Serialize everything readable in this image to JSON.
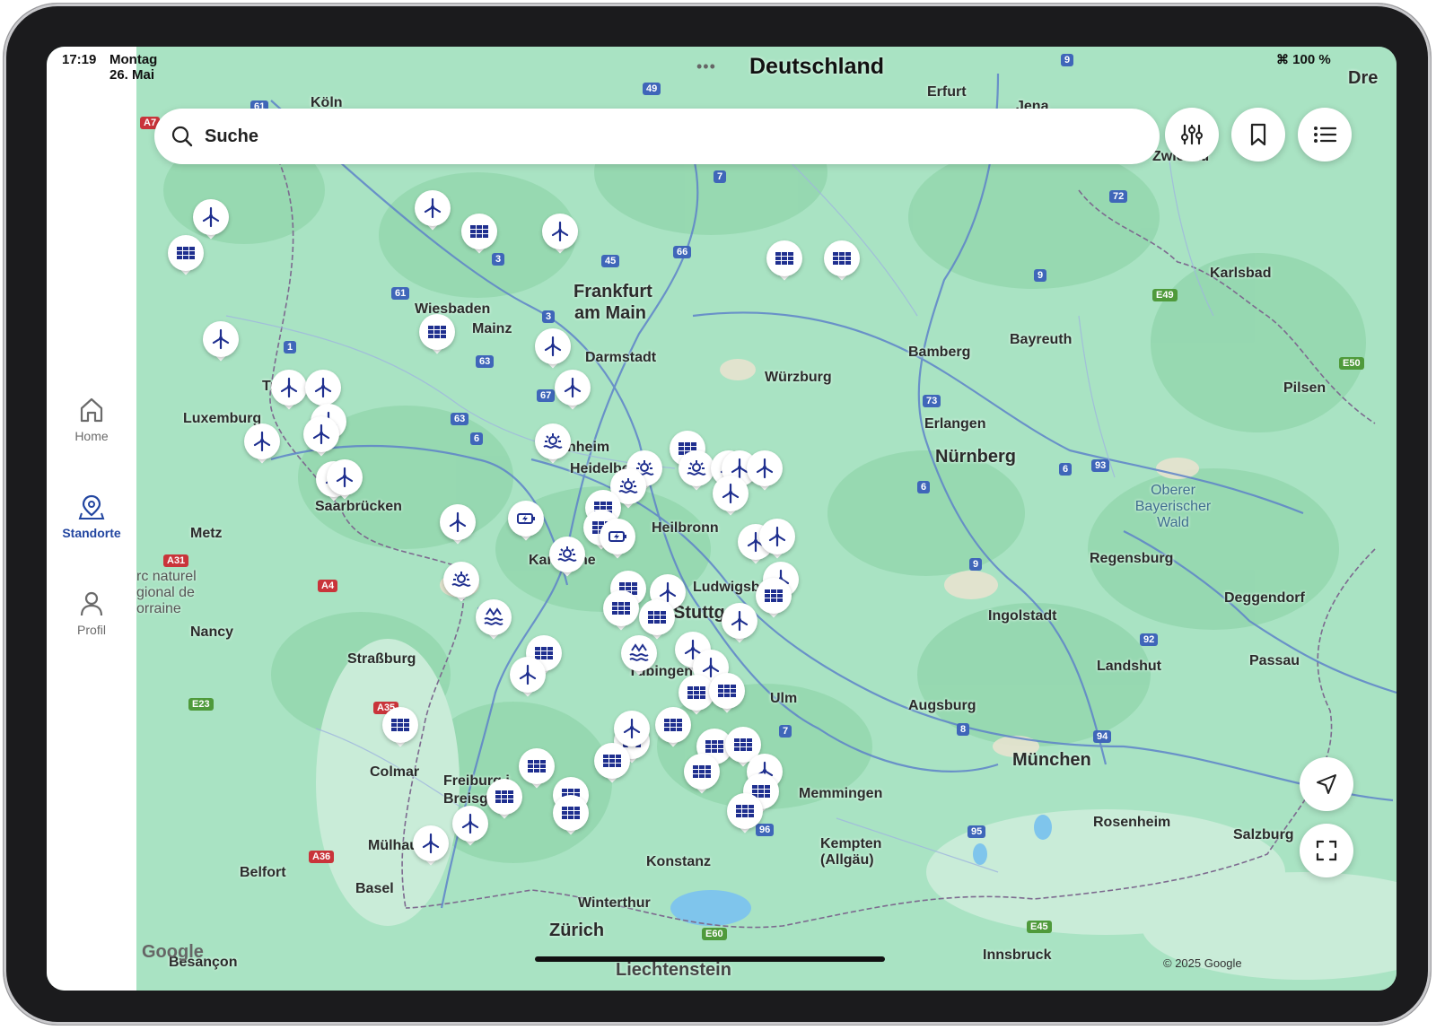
{
  "status_bar": {
    "time": "17:19",
    "date": "Montag 26. Mai",
    "battery": "100 %"
  },
  "sidebar": {
    "items": [
      {
        "label": "Home",
        "icon": "home-icon",
        "active": false
      },
      {
        "label": "Standorte",
        "icon": "location-pin-icon",
        "active": true
      },
      {
        "label": "Profil",
        "icon": "person-icon",
        "active": false
      }
    ]
  },
  "search": {
    "placeholder": "Suche"
  },
  "toolbar": {
    "filter_icon": "sliders-icon",
    "bookmark_icon": "bookmark-icon",
    "list_icon": "list-icon"
  },
  "map_controls": {
    "locate_icon": "navigation-arrow-icon",
    "fullscreen_icon": "fullscreen-icon"
  },
  "map": {
    "country_label": "Deutschland",
    "cities": [
      "Köln",
      "Erfurt",
      "Jena",
      "Zwickau",
      "Dre",
      "Frankfurt",
      "am Main",
      "Wiesbaden",
      "Mainz",
      "Darmstadt",
      "Trier",
      "Luxemburg",
      "Würzburg",
      "Bamberg",
      "Bayreuth",
      "Karlsbad",
      "Pilsen",
      "Erlangen",
      "Nürnberg",
      "Mannheim",
      "Heidelberg",
      "Heilbronn",
      "Saarbrücken",
      "Metz",
      "Karlsruhe",
      "Ludwigsburg",
      "Stuttgart",
      "Regensburg",
      "Ingolstadt",
      "Deggendorf",
      "Nancy",
      "Straßburg",
      "Tübingen",
      "Landshut",
      "Passau",
      "Ulm",
      "Augsburg",
      "München",
      "Colmar",
      "Freiburg i.",
      "Breisgau",
      "Memmingen",
      "Rosenheim",
      "Salzburg",
      "Mülhausen",
      "Kempten",
      "(Allgäu)",
      "Konstanz",
      "Belfort",
      "Basel",
      "Winterthur",
      "Zürich",
      "Innsbruck",
      "Besançon",
      "Liechtenstein"
    ],
    "regions": [
      "Oberer",
      "Bayerischer",
      "Wald",
      "rc naturel",
      "gional de",
      "orraine"
    ],
    "credit": "© 2025 Google",
    "logo": "Google"
  },
  "colors": {
    "accent": "#2346a0",
    "pin_icon": "#1f2f8f",
    "map_bg": "#a9e3c3",
    "road": "#5e83c9"
  }
}
